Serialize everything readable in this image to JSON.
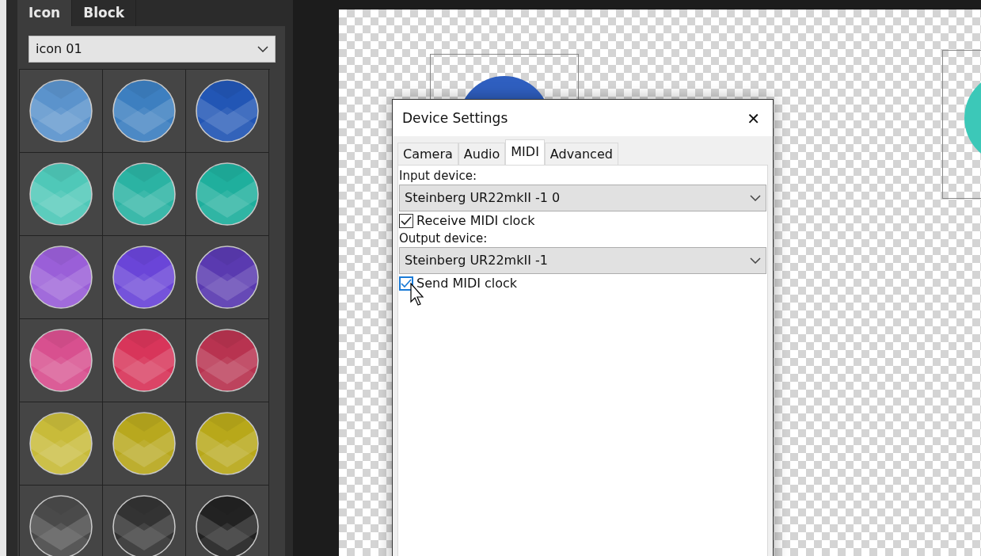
{
  "panel": {
    "tabs": [
      {
        "label": "Icon",
        "selected": true
      },
      {
        "label": "Block",
        "selected": false
      }
    ],
    "dropdown": {
      "value": "icon 01"
    },
    "icons": [
      {
        "color": "#5b93cc"
      },
      {
        "color": "#3d7fc0"
      },
      {
        "color": "#2256b5"
      },
      {
        "color": "#4fc8b8"
      },
      {
        "color": "#2bb3a3"
      },
      {
        "color": "#1faf9d"
      },
      {
        "color": "#9a5fd8"
      },
      {
        "color": "#6a45d8"
      },
      {
        "color": "#5a3ab0"
      },
      {
        "color": "#d8508f"
      },
      {
        "color": "#d8355a"
      },
      {
        "color": "#b83350"
      },
      {
        "color": "#c8bb3a"
      },
      {
        "color": "#b8a81e"
      },
      {
        "color": "#b8a81a"
      },
      {
        "color": "#4a4a4a"
      },
      {
        "color": "#333333"
      },
      {
        "color": "#222222"
      }
    ]
  },
  "canvas": {
    "items": [
      {
        "color": "#2f5fc0"
      },
      {
        "color": "#3cc8b8"
      }
    ]
  },
  "dialog": {
    "title": "Device Settings",
    "close": "✕",
    "tabs": [
      {
        "label": "Camera",
        "selected": false
      },
      {
        "label": "Audio",
        "selected": false
      },
      {
        "label": "MIDI",
        "selected": true
      },
      {
        "label": "Advanced",
        "selected": false
      }
    ],
    "fields": [
      {
        "kind": "label",
        "text": "Input device:"
      },
      {
        "kind": "select",
        "value": "Steinberg UR22mkII -1 0"
      },
      {
        "kind": "checkbox",
        "label": "Receive MIDI clock",
        "checked": true,
        "focused": false
      },
      {
        "kind": "label",
        "text": "Output device:"
      },
      {
        "kind": "select",
        "value": "Steinberg UR22mkII -1"
      },
      {
        "kind": "checkbox",
        "label": "Send MIDI clock",
        "checked": true,
        "focused": true
      }
    ]
  }
}
